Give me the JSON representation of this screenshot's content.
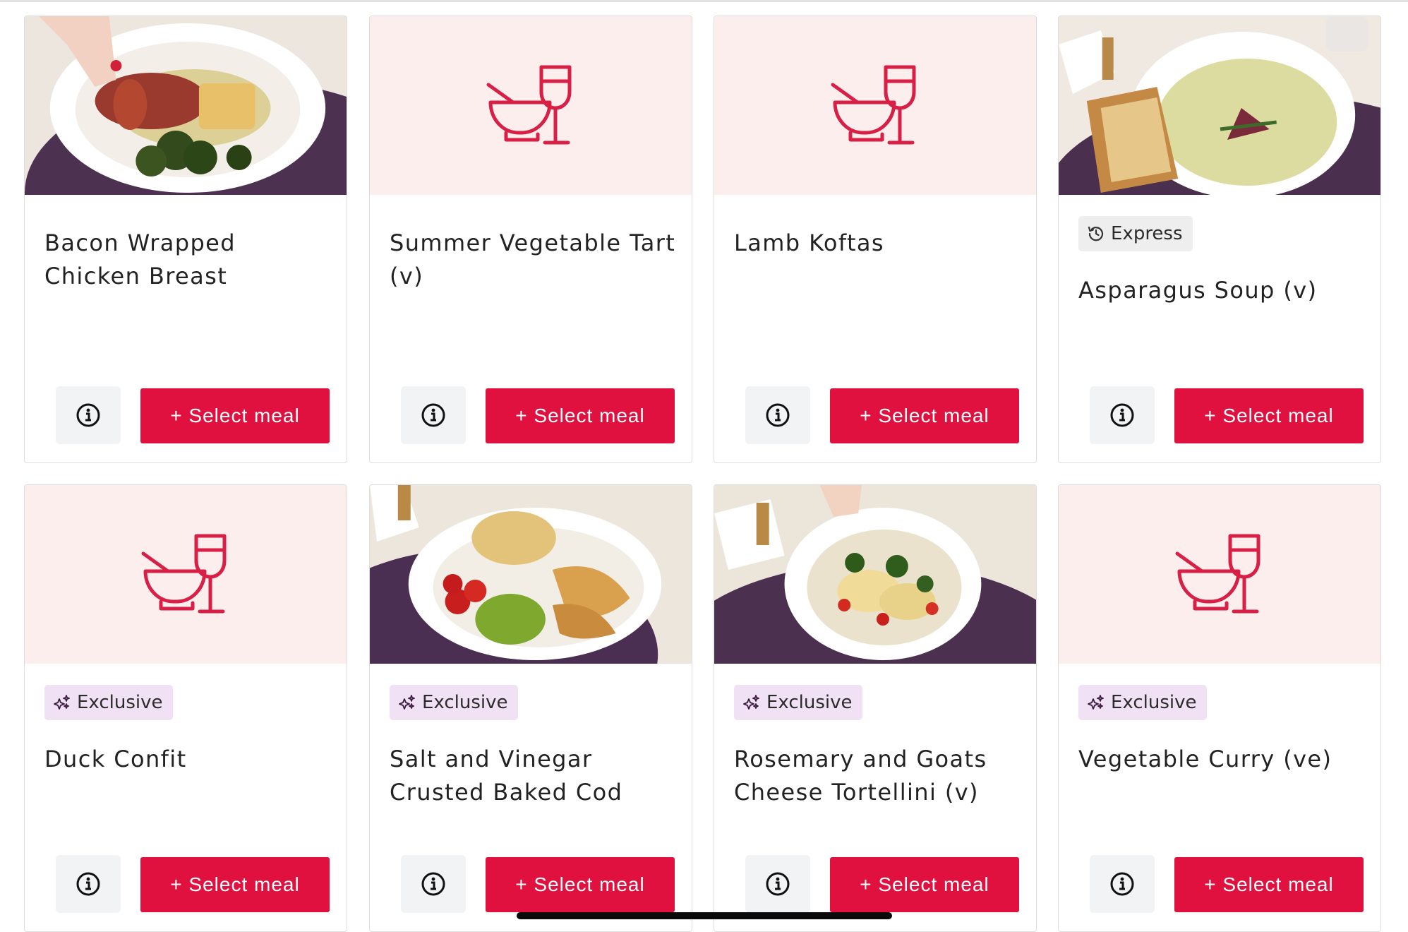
{
  "colors": {
    "accent": "#e0103f",
    "placeholder_bg": "#fdeeee",
    "exclusive_badge_bg": "#f1e1f5",
    "express_badge_bg": "#eeeeee",
    "info_button_bg": "#f2f3f5"
  },
  "meals": [
    {
      "title": "Bacon Wrapped Chicken Breast",
      "badge": "",
      "image": "photo-chicken",
      "info_icon": "info-icon",
      "select_label": "+ Select meal"
    },
    {
      "title": "Summer Vegetable Tart (v)",
      "badge": "",
      "image": "placeholder-bowl-wine-icon",
      "info_icon": "info-icon",
      "select_label": "+ Select meal"
    },
    {
      "title": "Lamb Koftas",
      "badge": "",
      "image": "placeholder-bowl-wine-icon",
      "info_icon": "info-icon",
      "select_label": "+ Select meal"
    },
    {
      "title": "Asparagus Soup (v)",
      "badge": "Express",
      "badge_icon": "clock-history-icon",
      "image": "photo-soup",
      "info_icon": "info-icon",
      "select_label": "+ Select meal"
    },
    {
      "title": "Duck Confit",
      "badge": "Exclusive",
      "badge_icon": "sparkles-icon",
      "image": "placeholder-bowl-wine-icon",
      "info_icon": "info-icon",
      "select_label": "+ Select meal"
    },
    {
      "title": "Salt and Vinegar Crusted Baked Cod",
      "badge": "Exclusive",
      "badge_icon": "sparkles-icon",
      "image": "photo-cod",
      "info_icon": "info-icon",
      "select_label": "+ Select meal"
    },
    {
      "title": "Rosemary and Goats Cheese Tortellini (v)",
      "badge": "Exclusive",
      "badge_icon": "sparkles-icon",
      "image": "photo-tortellini",
      "info_icon": "info-icon",
      "select_label": "+ Select meal"
    },
    {
      "title": "Vegetable Curry (ve)",
      "badge": "Exclusive",
      "badge_icon": "sparkles-icon",
      "image": "placeholder-bowl-wine-icon",
      "info_icon": "info-icon",
      "select_label": "+ Select meal"
    }
  ]
}
